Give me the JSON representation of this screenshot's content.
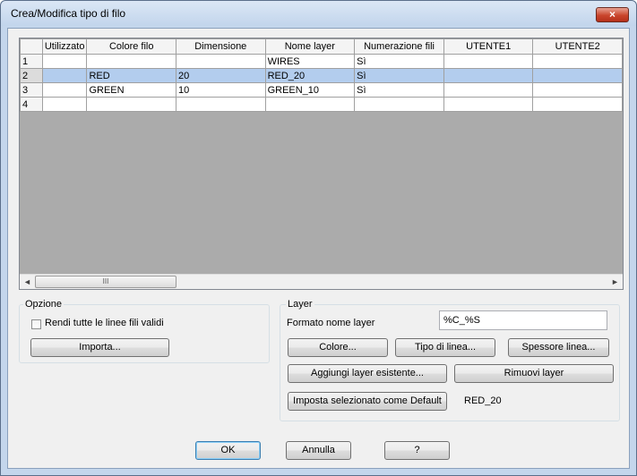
{
  "window": {
    "title": "Crea/Modifica tipo di filo",
    "close_label": "×"
  },
  "grid": {
    "columns": [
      "",
      "Utilizzato",
      "Colore filo",
      "Dimensione",
      "Nome layer",
      "Numerazione fili",
      "UTENTE1",
      "UTENTE2"
    ],
    "rows": [
      {
        "num": "1",
        "cells": [
          "",
          "",
          "",
          "WIRES",
          "Sì",
          "",
          ""
        ],
        "selected": false
      },
      {
        "num": "2",
        "cells": [
          "",
          "RED",
          "20",
          "RED_20",
          "Sì",
          "",
          ""
        ],
        "selected": true
      },
      {
        "num": "3",
        "cells": [
          "",
          "GREEN",
          "10",
          "GREEN_10",
          "Sì",
          "",
          ""
        ],
        "selected": false
      },
      {
        "num": "4",
        "cells": [
          "",
          "",
          "",
          "",
          "",
          "",
          ""
        ],
        "selected": false
      }
    ],
    "scroll_left": "◄",
    "scroll_right": "►",
    "scroll_thumb": "III"
  },
  "opzione": {
    "label": "Opzione",
    "checkbox_label": "Rendi tutte le linee fili validi",
    "import_button": "Importa..."
  },
  "layer": {
    "label": "Layer",
    "format_label": "Formato nome layer",
    "format_value": "%C_%S",
    "color_button": "Colore...",
    "linetype_button": "Tipo di linea...",
    "lineweight_button": "Spessore linea...",
    "add_existing_button": "Aggiungi layer esistente...",
    "remove_button": "Rimuovi layer",
    "set_default_button": "Imposta selezionato come Default",
    "default_value": "RED_20"
  },
  "footer": {
    "ok": "OK",
    "cancel": "Annulla",
    "help": "?"
  }
}
